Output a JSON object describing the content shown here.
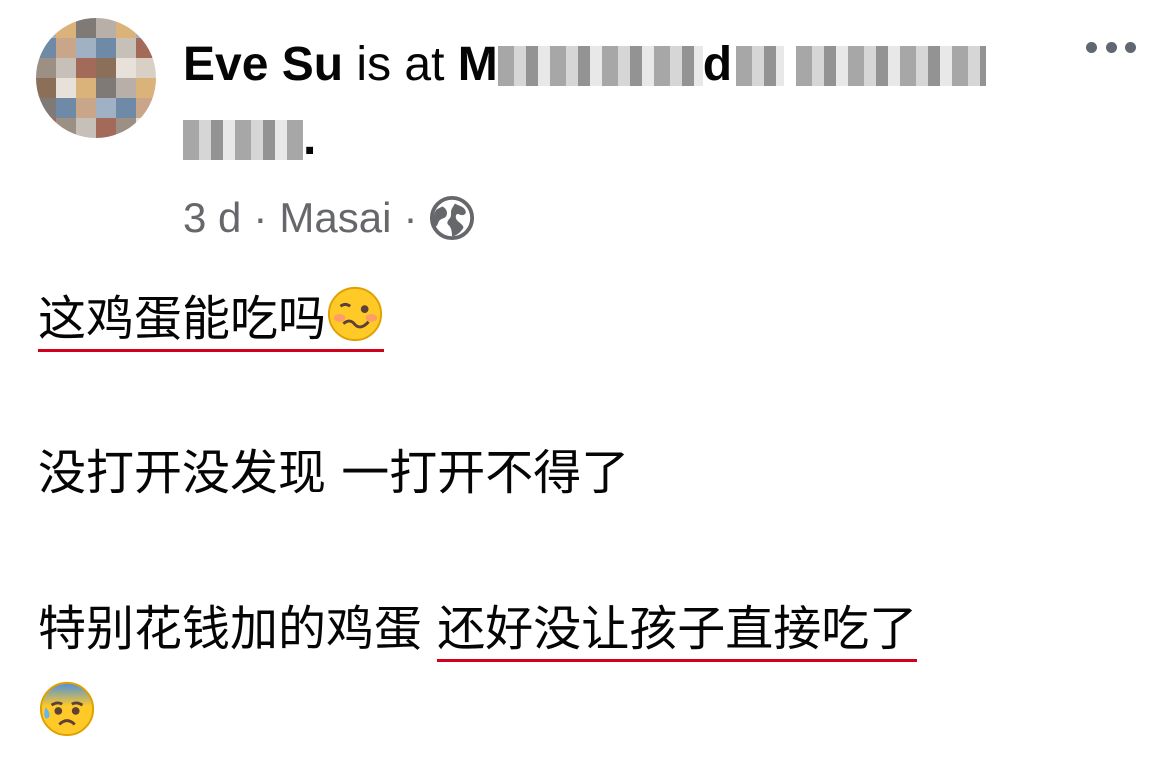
{
  "post": {
    "author": "Eve Su",
    "action": " is at ",
    "place_start": "M",
    "place_mid": "d",
    "place_end": ".",
    "time": "3 d",
    "separator": "·",
    "location": "Masai",
    "audience_icon": "globe-icon",
    "more_icon": "more-horizontal-icon"
  },
  "content": {
    "line1": "这鸡蛋能吃吗",
    "line1_emoji": "woozy-face-emoji",
    "line2": "没打开没发现 一打开不得了",
    "line3_a": "特别花钱加的鸡蛋 ",
    "line3_b": "还好没让孩子直接吃了",
    "line4_emoji": "anxious-face-with-sweat-emoji"
  },
  "colors": {
    "underline": "#d0021b",
    "meta_text": "#65676b",
    "body_text": "#050505"
  }
}
